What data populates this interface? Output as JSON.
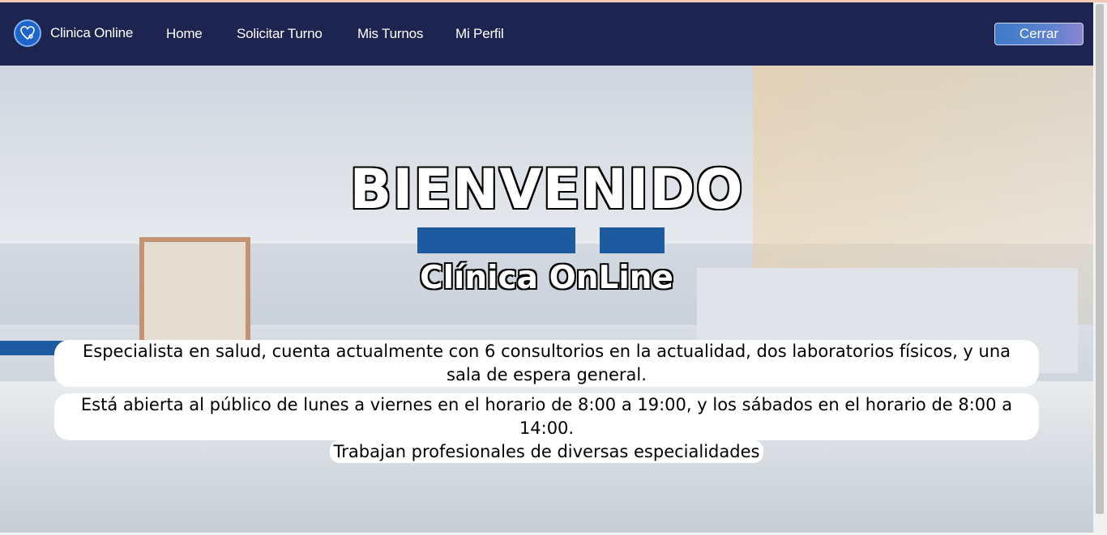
{
  "navbar": {
    "brand": "Clinica Online",
    "links": [
      "Home",
      "Solicitar Turno",
      "Mis Turnos",
      "Mi Perfil"
    ],
    "logout_label": "Cerrar"
  },
  "hero": {
    "welcome": "BIENVENIDO",
    "subtitle": "Clínica OnLine",
    "paragraphs": [
      "Especialista en salud, cuenta actualmente con 6 consultorios en la actualidad, dos laboratorios físicos, y una sala de espera general.",
      "Está abierta al público de lunes a viernes en el horario de 8:00 a 19:00, y los sábados en el horario de 8:00 a 14:00.",
      "Trabajan profesionales de diversas especialidades"
    ]
  },
  "colors": {
    "navbar_bg": "#1c244f",
    "logout_gradient_start": "#3e79c8",
    "logout_gradient_end": "#8a85cf"
  },
  "icons": {
    "logo": "stethoscope-heart-icon"
  }
}
